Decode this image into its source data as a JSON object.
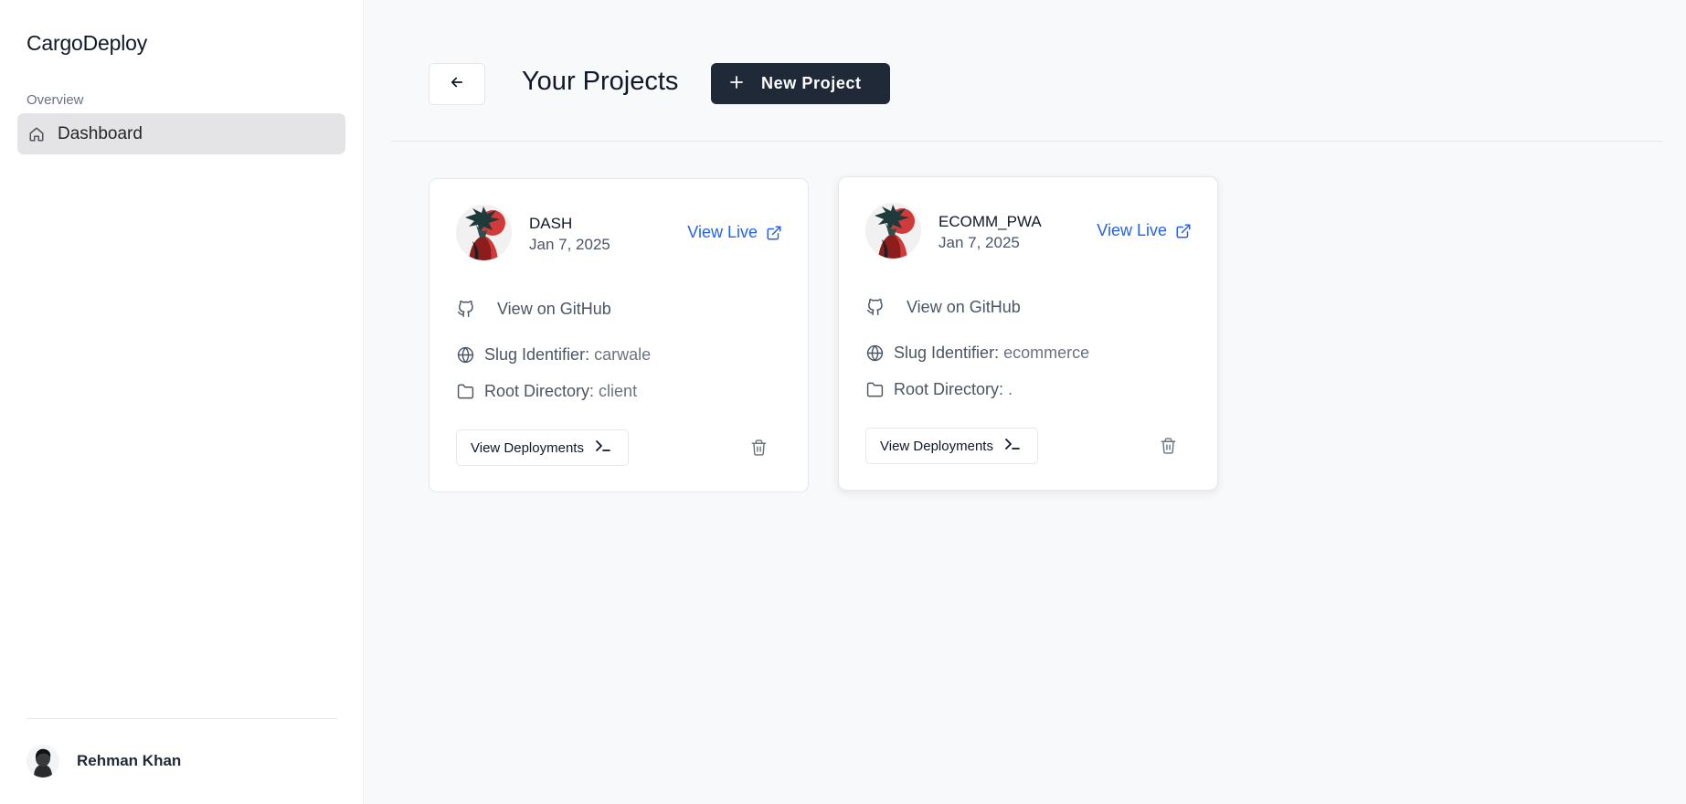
{
  "app": {
    "brand": "CargoDeploy"
  },
  "sidebar": {
    "section_label": "Overview",
    "items": [
      {
        "label": "Dashboard",
        "icon": "home-icon",
        "active": true
      }
    ],
    "user": {
      "name": "Rehman Khan"
    }
  },
  "header": {
    "title": "Your Projects",
    "new_project_label": "New Project"
  },
  "projects": [
    {
      "name": "DASH",
      "date": "Jan 7, 2025",
      "view_live_label": "View Live",
      "github_label": "View on GitHub",
      "slug_key": "Slug Identifier:",
      "slug_value": "carwale",
      "root_key": "Root Directory:",
      "root_value": "client",
      "deployments_label": "View Deployments"
    },
    {
      "name": "ECOMM_PWA",
      "date": "Jan 7, 2025",
      "view_live_label": "View Live",
      "github_label": "View on GitHub",
      "slug_key": "Slug Identifier:",
      "slug_value": "ecommerce",
      "root_key": "Root Directory:",
      "root_value": ".",
      "deployments_label": "View Deployments"
    }
  ],
  "colors": {
    "accent_link": "#2563eb",
    "primary_button": "#1f2937",
    "active_nav": "#e4e4e7"
  }
}
